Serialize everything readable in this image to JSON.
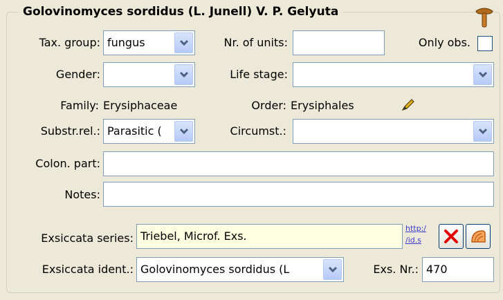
{
  "header": {
    "title": "Golovinomyces sordidus (L. Junell) V. P. Gelyuta",
    "icon": "mushroom-icon"
  },
  "labels": {
    "tax_group": "Tax. group:",
    "nr_units": "Nr. of units:",
    "only_obs": "Only obs.",
    "gender": "Gender:",
    "life_stage": "Life stage:",
    "family": "Family:",
    "order": "Order:",
    "substr_rel": "Substr.rel.:",
    "circumst": "Circumst.:",
    "colon_part": "Colon. part:",
    "notes": "Notes:",
    "exsiccata_series": "Exsiccata series:",
    "exsiccata_ident": "Exsiccata ident.:",
    "exs_nr": "Exs. Nr.:"
  },
  "fields": {
    "tax_group": "fungus",
    "nr_units": "",
    "only_obs_checked": false,
    "gender": "",
    "life_stage": "",
    "substr_rel": "Parasitic (",
    "circumst": "",
    "colon_part": "",
    "notes": "",
    "exsiccata_series": "Triebel, Microf. Exs.",
    "exsiccata_ident": "Golovinomyces sordidus (L",
    "exs_nr": "470"
  },
  "values": {
    "family": "Erysiphaceae",
    "order": "Erysiphales"
  },
  "links": {
    "http_line1": "http:/",
    "http_line2": "/id.s"
  },
  "icons": {
    "edit": "pencil-icon",
    "clear": "red-x-icon",
    "lookup": "shell-icon",
    "dropdown": "chevron-down-icon"
  },
  "colors": {
    "background": "#ECE9D8",
    "highlight_field": "#FFFFE1",
    "field_border": "#7F9DB9",
    "accent_blue": "#B6CAF7"
  }
}
